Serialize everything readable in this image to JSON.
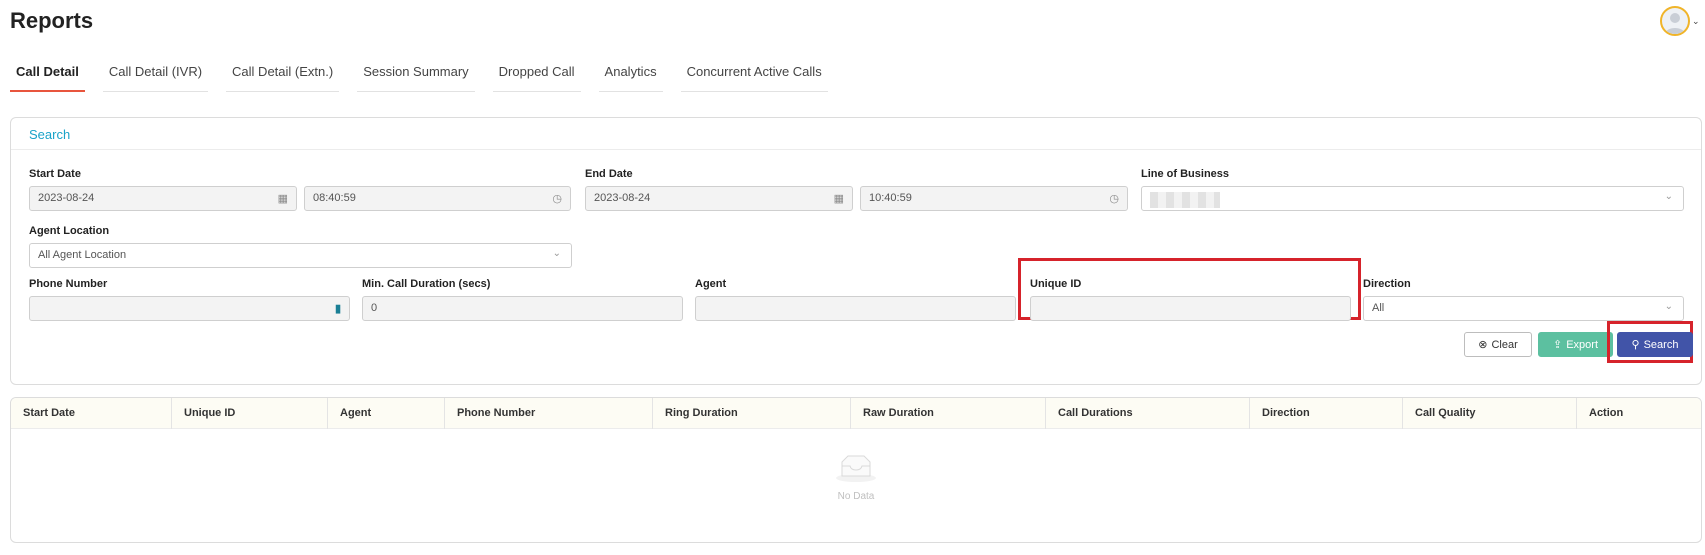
{
  "page": {
    "title": "Reports"
  },
  "user": {
    "avatar_icon": "user-avatar-icon",
    "menu_icon": "chevron-down-icon"
  },
  "tabs": [
    {
      "label": "Call Detail",
      "active": true
    },
    {
      "label": "Call Detail (IVR)"
    },
    {
      "label": "Call Detail (Extn.)"
    },
    {
      "label": "Session Summary"
    },
    {
      "label": "Dropped Call"
    },
    {
      "label": "Analytics"
    },
    {
      "label": "Concurrent Active Calls"
    }
  ],
  "search": {
    "title": "Search",
    "start_date": {
      "label": "Start Date",
      "date": "2023-08-24",
      "time": "08:40:59"
    },
    "end_date": {
      "label": "End Date",
      "date": "2023-08-24",
      "time": "10:40:59"
    },
    "line_of_business": {
      "label": "Line of Business",
      "value": ""
    },
    "agent_location": {
      "label": "Agent Location",
      "value": "All Agent Location"
    },
    "phone_number": {
      "label": "Phone Number",
      "value": ""
    },
    "min_call_duration": {
      "label": "Min. Call Duration (secs)",
      "value": "0"
    },
    "agent": {
      "label": "Agent",
      "value": ""
    },
    "unique_id": {
      "label": "Unique ID",
      "value": ""
    },
    "direction": {
      "label": "Direction",
      "value": "All"
    },
    "buttons": {
      "clear": "Clear",
      "export": "Export",
      "search": "Search"
    }
  },
  "table": {
    "columns": [
      "Start Date",
      "Unique ID",
      "Agent",
      "Phone Number",
      "Ring Duration",
      "Raw Duration",
      "Call Durations",
      "Direction",
      "Call Quality",
      "Action"
    ],
    "empty_text": "No Data"
  },
  "colors": {
    "accent_tab": "#e8553d",
    "search_title": "#1aa3c8",
    "search_button": "#4154a8",
    "export_button": "#5cc0a0",
    "highlight": "#d6232b"
  }
}
